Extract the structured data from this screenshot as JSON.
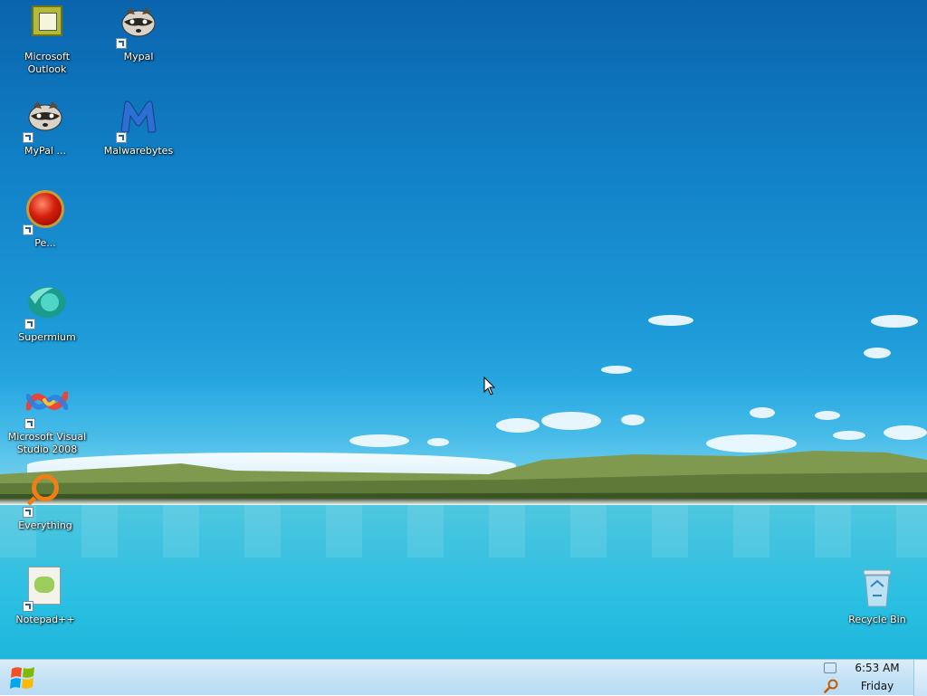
{
  "desktop": {
    "icons": [
      {
        "label": "Microsoft Outlook",
        "icon": "outlook-icon"
      },
      {
        "label": "Mypal",
        "icon": "raccoon-icon"
      },
      {
        "label": "MyPal ...",
        "icon": "raccoon-icon"
      },
      {
        "label": "Malwarebytes",
        "icon": "malwarebytes-icon"
      },
      {
        "label": "Pe...",
        "icon": "red-ball-icon"
      },
      {
        "label": "Supermium",
        "icon": "supermium-icon"
      },
      {
        "label": "Microsoft Visual Studio 2008",
        "icon": "visual-studio-icon"
      },
      {
        "label": "Everything",
        "icon": "everything-search-icon"
      },
      {
        "label": "Notepad++",
        "icon": "notepad-plus-plus-icon"
      },
      {
        "label": "Recycle Bin",
        "icon": "recycle-bin-icon"
      }
    ]
  },
  "taskbar": {
    "start_icon": "windows-logo-icon",
    "clock": {
      "time": "6:53 AM",
      "day": "Friday"
    },
    "tray_icons": [
      "network-icon",
      "search-icon"
    ]
  },
  "colors": {
    "taskbar_bg": "#c6e3f6",
    "sky_top": "#0a64ad",
    "lake": "#29bfe2"
  }
}
